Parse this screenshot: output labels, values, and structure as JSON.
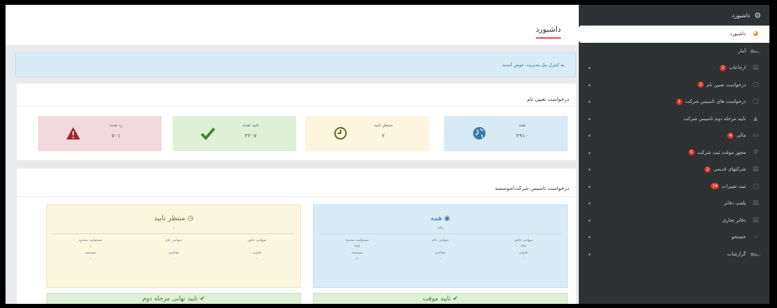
{
  "sidebar": {
    "header": "داشبورد",
    "items": [
      {
        "label": "داشبورد",
        "icon": "palette-icon",
        "badge": "",
        "active": true
      },
      {
        "label": "آمار",
        "icon": "bar-chart-icon",
        "badge": ""
      },
      {
        "label": "ارجاعات",
        "icon": "document-icon",
        "badge": "3"
      },
      {
        "label": "درخواست تعیین نام",
        "icon": "edit-icon",
        "badge": "2"
      },
      {
        "label": "درخواست های تاسیس شرکت",
        "icon": "edit-icon",
        "badge": "1"
      },
      {
        "label": "تایید مرحله دوم تاسیس شرکت",
        "icon": "lock-icon",
        "badge": ""
      },
      {
        "label": "مالی",
        "icon": "money-icon",
        "badge": "4"
      },
      {
        "label": "مجوز موقت ثبت شرکت",
        "icon": "key-icon",
        "badge": "5"
      },
      {
        "label": "شرکتهای قدیمی",
        "icon": "document-icon",
        "badge": "2"
      },
      {
        "label": "ثبت تغییرات",
        "icon": "edit-icon",
        "badge": "19"
      },
      {
        "label": "پلمپ دفاتر",
        "icon": "document-icon",
        "badge": ""
      },
      {
        "label": "دفاتر تجاری",
        "icon": "document-icon",
        "badge": ""
      },
      {
        "label": "جستجو",
        "icon": "search-icon",
        "badge": ""
      },
      {
        "label": "گزارشات",
        "icon": "bar-chart-icon",
        "badge": ""
      }
    ]
  },
  "main": {
    "page_title": "داشبورد",
    "welcome": "به کنترل پنل مدیریت خوش آمدید.",
    "name_requests": {
      "title": "درخواست تعیین نام",
      "stats": [
        {
          "label": "همه",
          "value": "۲۹۱۰"
        },
        {
          "label": "منتظر تایید",
          "value": "۲"
        },
        {
          "label": "تایید شده",
          "value": "۲۲۰۷"
        },
        {
          "label": "رد شده",
          "value": "۷۰۱"
        }
      ]
    },
    "company": {
      "title": "درخواست تاسیس شرکت/موسسه",
      "all": {
        "title": "همه",
        "count": "۶۳۸",
        "cols": [
          [
            "سهامی خاص",
            "۳۷۶",
            "تعاونی",
            "-"
          ],
          [
            "سهامی عام",
            "-",
            "تضامنی",
            "-"
          ],
          [
            "مسئولیت محدود",
            "۲۸۸",
            "موسسه",
            "۱۱"
          ]
        ]
      },
      "wait": {
        "title": "منتظر تایید",
        "count": "۱",
        "cols": [
          [
            "سهامی خاص",
            "-",
            "تعاونی",
            "-"
          ],
          [
            "سهامی عام",
            "-",
            "تضامنی",
            "-"
          ],
          [
            "مسئولیت محدود",
            "۱",
            "موسسه",
            "-"
          ]
        ]
      },
      "temp_ok": "تایید موقت",
      "final_ok": "تایید نهایی مرحله دوم"
    }
  }
}
